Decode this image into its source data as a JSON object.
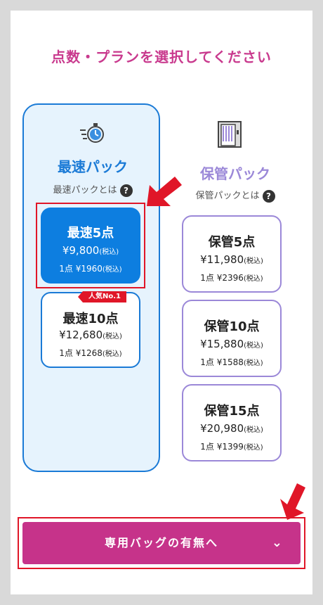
{
  "heading": "点数・プランを選択してください",
  "fast_pack": {
    "name": "最速パック",
    "about": "最速パックとは",
    "options": [
      {
        "name": "最速5点",
        "price": "¥9,800",
        "tax": "(税込)",
        "unit": "1点 ¥1960",
        "unit_tax": "(税込)",
        "selected": true
      },
      {
        "name": "最速10点",
        "price": "¥12,680",
        "tax": "(税込)",
        "unit": "1点 ¥1268",
        "unit_tax": "(税込)",
        "badge": "人気No.1"
      }
    ]
  },
  "storage_pack": {
    "name": "保管パック",
    "about": "保管パックとは",
    "options": [
      {
        "name": "保管5点",
        "price": "¥11,980",
        "tax": "(税込)",
        "unit": "1点 ¥2396",
        "unit_tax": "(税込)"
      },
      {
        "name": "保管10点",
        "price": "¥15,880",
        "tax": "(税込)",
        "unit": "1点 ¥1588",
        "unit_tax": "(税込)"
      },
      {
        "name": "保管15点",
        "price": "¥20,980",
        "tax": "(税込)",
        "unit": "1点 ¥1399",
        "unit_tax": "(税込)"
      }
    ]
  },
  "help_glyph": "?",
  "next_button": "専用バッグの有無へ",
  "next_chevron": "⌄",
  "icons": {
    "fast": "stopwatch-icon",
    "storage": "wardrobe-icon",
    "help": "question-icon",
    "pointer": "red-arrow-icon"
  },
  "colors": {
    "accent": "#c6338a",
    "fast": "#1a7ad6",
    "storage": "#9b88d8",
    "highlight": "#e01628"
  }
}
